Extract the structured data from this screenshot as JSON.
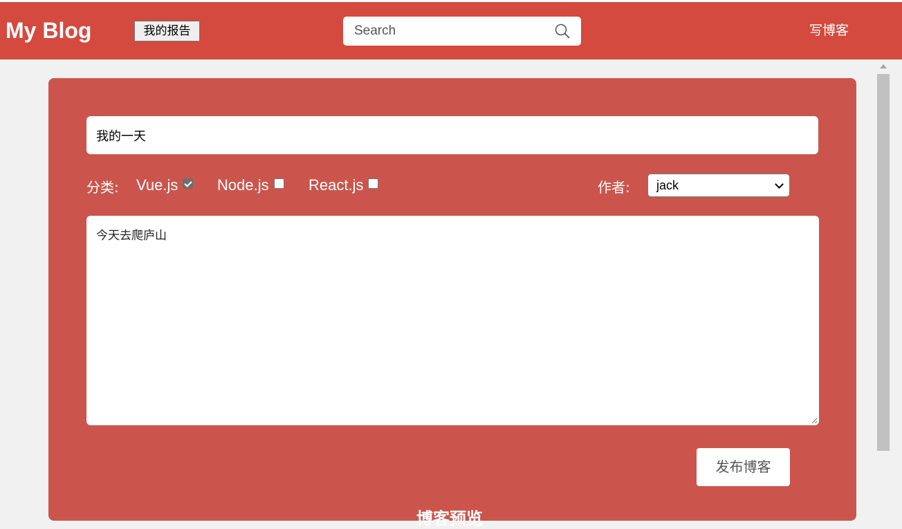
{
  "header": {
    "brand": "My Blog",
    "report_button": "我的报告",
    "search_placeholder": "Search",
    "write_link": "写博客"
  },
  "editor": {
    "title_value": "我的一天",
    "category_label": "分类:",
    "categories": [
      {
        "label": "Vue.js",
        "checked": true
      },
      {
        "label": "Node.js",
        "checked": false
      },
      {
        "label": "React.js",
        "checked": false
      }
    ],
    "author_label": "作者:",
    "author_selected": "jack",
    "content_value": "今天去爬庐山",
    "publish_button": "发布博客",
    "preview_heading": "博客预览"
  },
  "colors": {
    "navbar": "#d44a3e",
    "card": "#cb554c",
    "background": "#f1f1f1"
  }
}
